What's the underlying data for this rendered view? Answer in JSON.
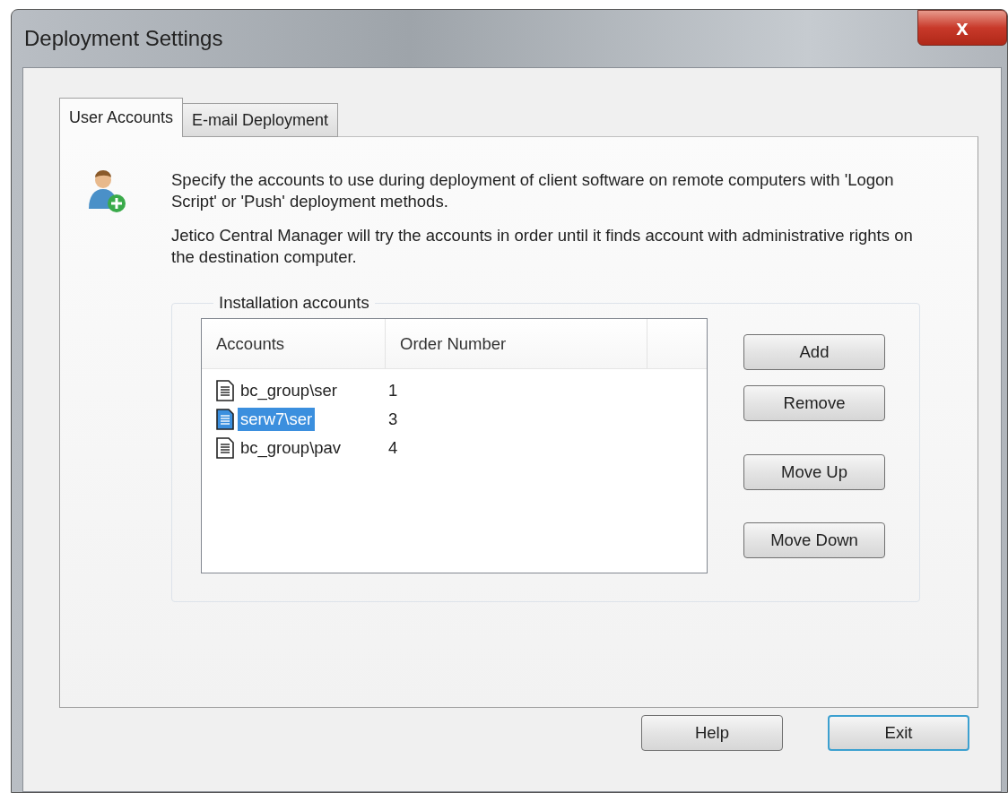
{
  "window": {
    "title": "Deployment Settings",
    "close_label": "x"
  },
  "tabs": [
    {
      "label": "User Accounts",
      "selected": true
    },
    {
      "label": "E-mail Deployment",
      "selected": false
    }
  ],
  "description": [
    "Specify the accounts to use during deployment of client software on remote computers with 'Logon Script' or 'Push' deployment methods.",
    "Jetico Central Manager will try the accounts in order until it finds account with administrative rights on the destination computer."
  ],
  "group": {
    "title": "Installation accounts",
    "table": {
      "columns": [
        "Accounts",
        "Order Number"
      ],
      "rows": [
        {
          "account": "bc_group\\ser",
          "order": "1",
          "selected": false
        },
        {
          "account": "serw7\\ser",
          "order": "3",
          "selected": true
        },
        {
          "account": "bc_group\\pav",
          "order": "4",
          "selected": false
        }
      ]
    },
    "buttons": [
      "Add",
      "Remove",
      "Move Up",
      "Move Down"
    ]
  },
  "footer_buttons": [
    {
      "label": "Help",
      "default": false
    },
    {
      "label": "Exit",
      "default": true
    }
  ]
}
